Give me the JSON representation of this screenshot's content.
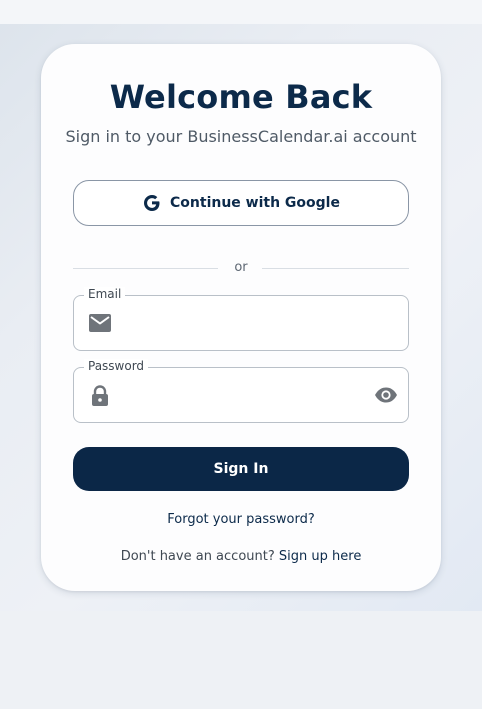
{
  "login": {
    "title": "Welcome Back",
    "subtitle": "Sign in to your BusinessCalendar.ai account",
    "google_button": {
      "label": "Continue with Google",
      "icon": "google-icon"
    },
    "divider_text": "or",
    "email": {
      "label": "Email",
      "value": "",
      "icon": "mail-icon"
    },
    "password": {
      "label": "Password",
      "value": "",
      "icon": "lock-icon",
      "toggle_icon": "eye-icon"
    },
    "signin_button": "Sign In",
    "forgot_password": "Forgot your password?",
    "signup_prompt": "Don't have an account?",
    "signup_link": "Sign up here"
  },
  "colors": {
    "primary": "#0b2747",
    "text_dark": "#0c2a4a",
    "text_muted": "#4f5a66",
    "border": "#b9c0c8",
    "background": "#eef1f5",
    "card": "#fdfdfe"
  }
}
